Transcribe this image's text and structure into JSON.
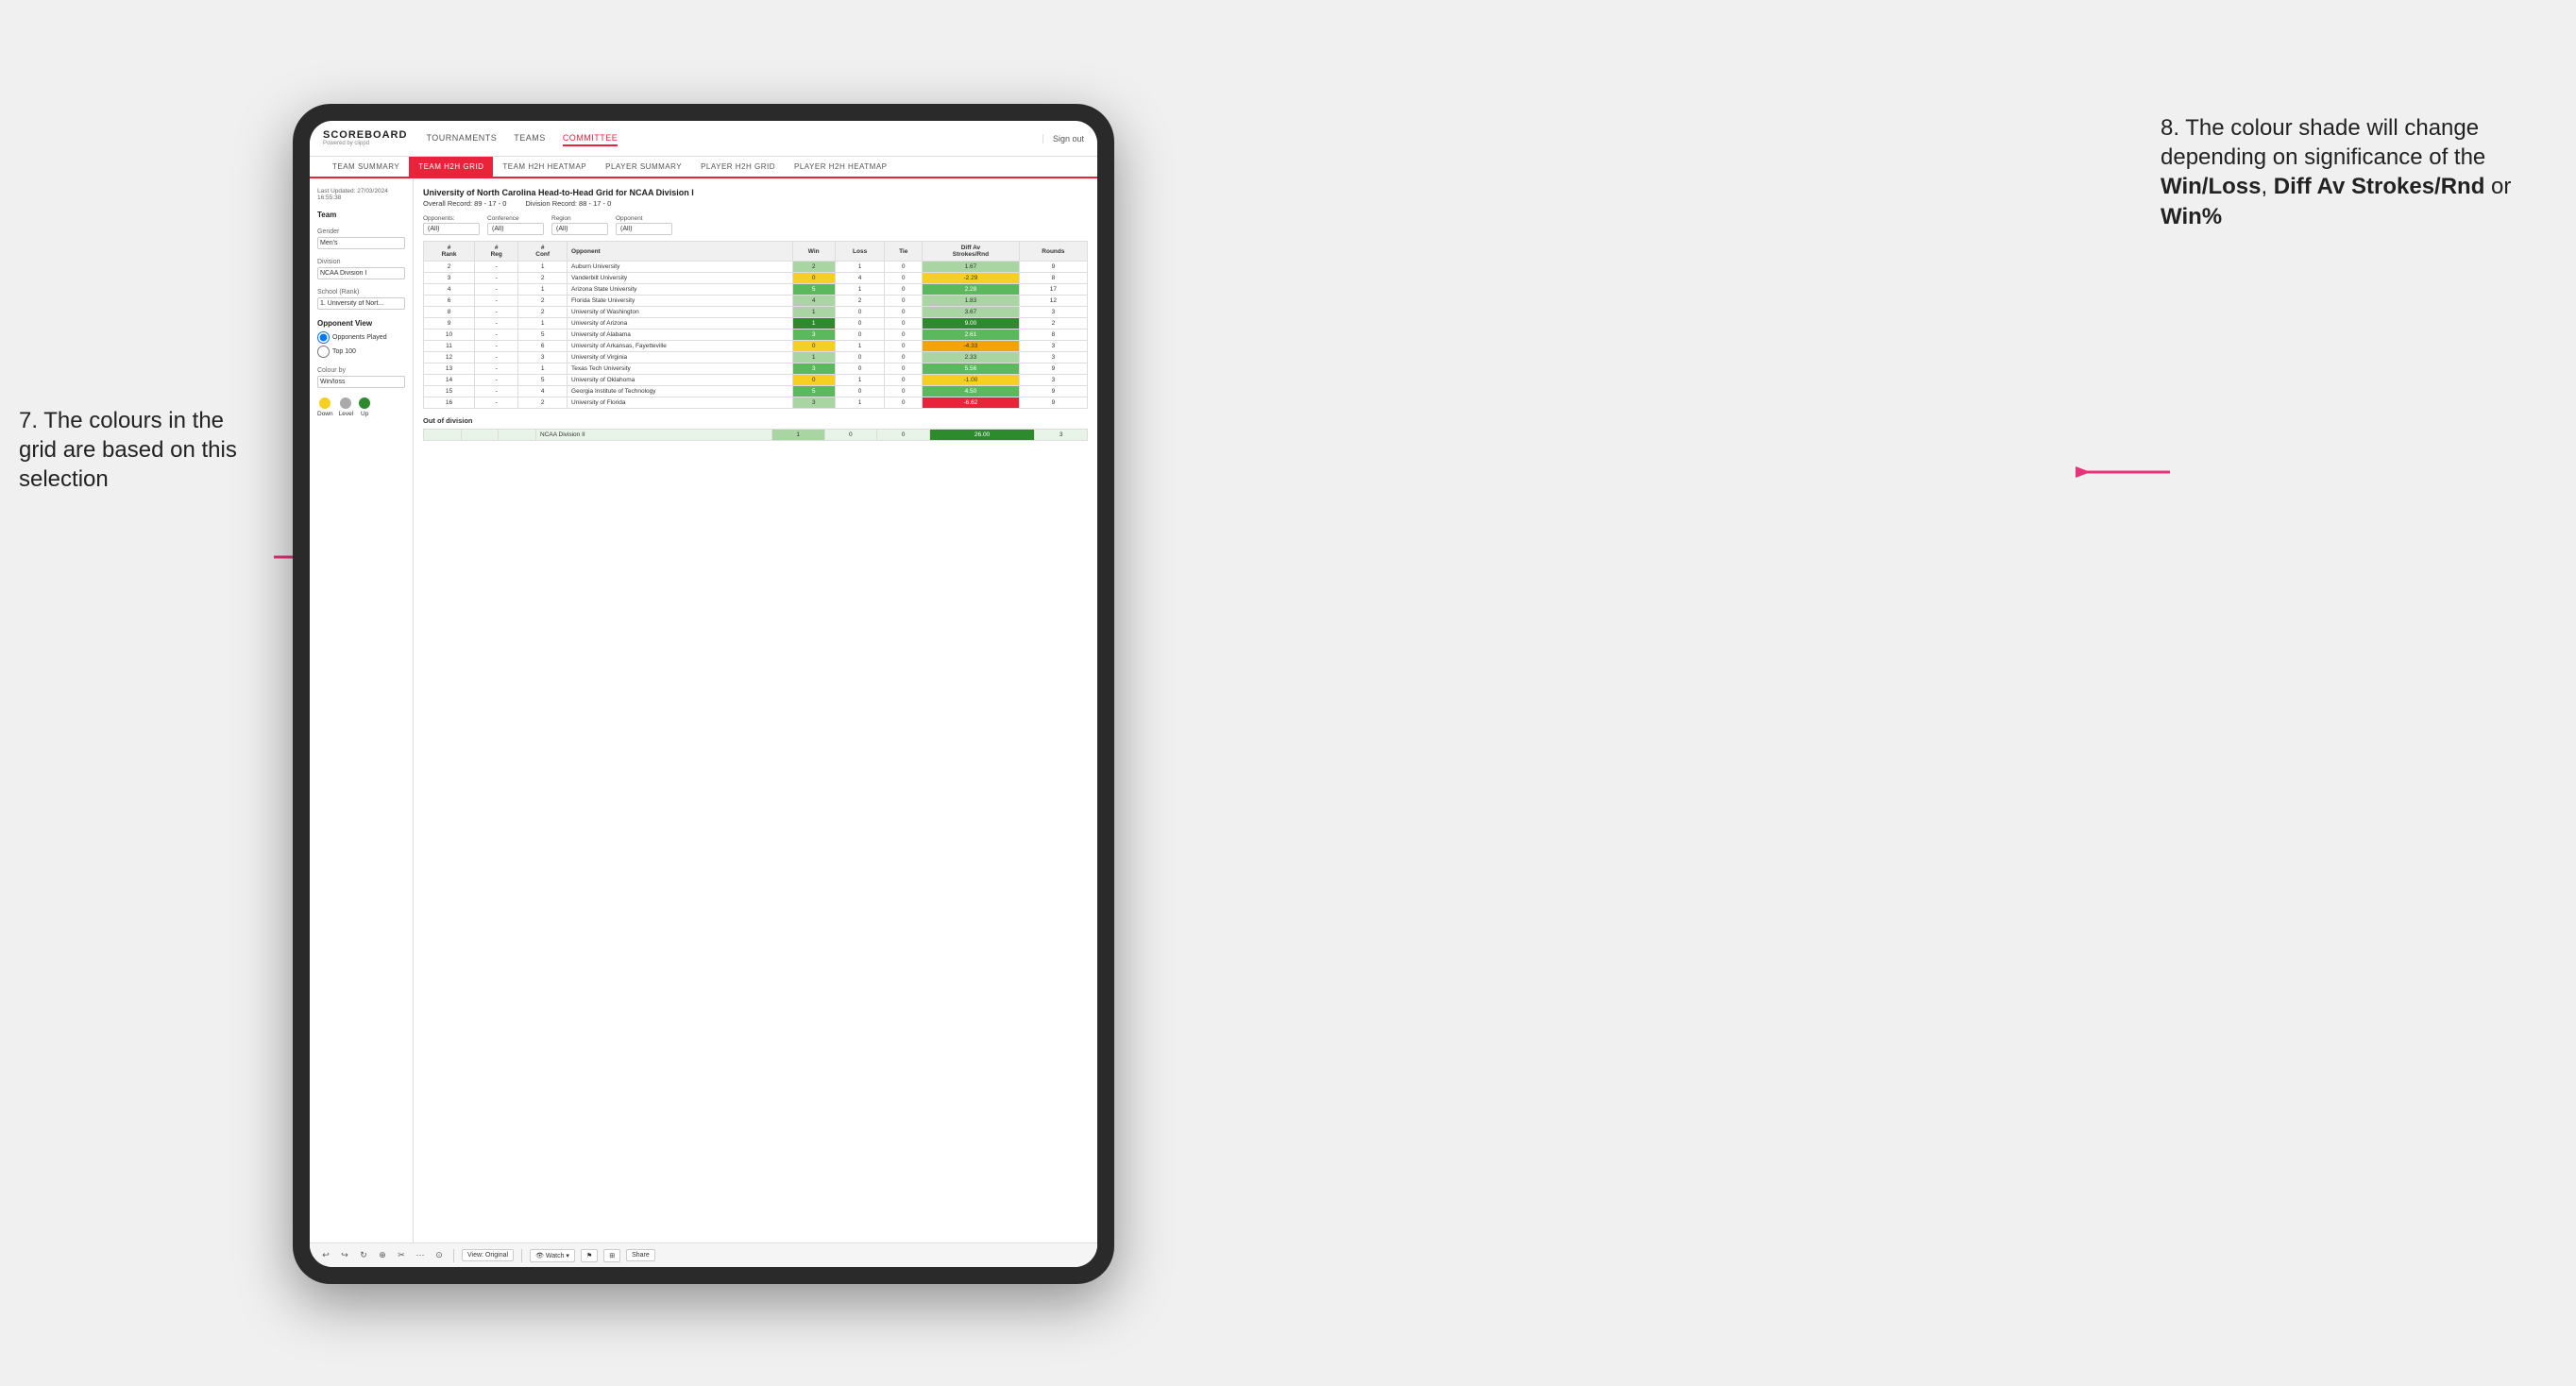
{
  "app": {
    "logo": "SCOREBOARD",
    "logo_sub": "Powered by clippd",
    "nav_items": [
      "TOURNAMENTS",
      "TEAMS",
      "COMMITTEE"
    ],
    "sign_out": "Sign out",
    "sub_nav_items": [
      "TEAM SUMMARY",
      "TEAM H2H GRID",
      "TEAM H2H HEATMAP",
      "PLAYER SUMMARY",
      "PLAYER H2H GRID",
      "PLAYER H2H HEATMAP"
    ],
    "active_sub_nav": "TEAM H2H GRID"
  },
  "sidebar": {
    "last_updated_label": "Last Updated: 27/03/2024",
    "last_updated_time": "16:55:38",
    "team_label": "Team",
    "gender_label": "Gender",
    "gender_value": "Men's",
    "division_label": "Division",
    "division_value": "NCAA Division I",
    "school_rank_label": "School (Rank)",
    "school_value": "1. University of Nort...",
    "opponent_view_label": "Opponent View",
    "opponents_played": "Opponents Played",
    "top100": "Top 100",
    "colour_by_label": "Colour by",
    "colour_by_value": "Win/loss",
    "legend_down": "Down",
    "legend_level": "Level",
    "legend_up": "Up"
  },
  "grid": {
    "title": "University of North Carolina Head-to-Head Grid for NCAA Division I",
    "overall_record": "Overall Record: 89 - 17 - 0",
    "division_record": "Division Record: 88 - 17 - 0",
    "opponents_label": "Opponents:",
    "opponents_value": "(All)",
    "conference_label": "Conference",
    "conference_value": "(All)",
    "region_label": "Region",
    "region_value": "(All)",
    "opponent_label": "Opponent",
    "opponent_value": "(All)",
    "col_headers": [
      "#\nRank",
      "#\nReg",
      "#\nConf",
      "Opponent",
      "Win",
      "Loss",
      "Tie",
      "Diff Av\nStrokes/Rnd",
      "Rounds"
    ],
    "rows": [
      {
        "rank": "2",
        "reg": "-",
        "conf": "1",
        "opponent": "Auburn University",
        "win": "2",
        "loss": "1",
        "tie": "0",
        "diff": "1.67",
        "rounds": "9",
        "win_color": "green-light",
        "diff_color": "green-light"
      },
      {
        "rank": "3",
        "reg": "-",
        "conf": "2",
        "opponent": "Vanderbilt University",
        "win": "0",
        "loss": "4",
        "tie": "0",
        "diff": "-2.29",
        "rounds": "8",
        "win_color": "yellow",
        "diff_color": "yellow"
      },
      {
        "rank": "4",
        "reg": "-",
        "conf": "1",
        "opponent": "Arizona State University",
        "win": "5",
        "loss": "1",
        "tie": "0",
        "diff": "2.28",
        "rounds": "17",
        "win_color": "green",
        "diff_color": "green"
      },
      {
        "rank": "6",
        "reg": "-",
        "conf": "2",
        "opponent": "Florida State University",
        "win": "4",
        "loss": "2",
        "tie": "0",
        "diff": "1.83",
        "rounds": "12",
        "win_color": "green-light",
        "diff_color": "green-light"
      },
      {
        "rank": "8",
        "reg": "-",
        "conf": "2",
        "opponent": "University of Washington",
        "win": "1",
        "loss": "0",
        "tie": "0",
        "diff": "3.67",
        "rounds": "3",
        "win_color": "green-light",
        "diff_color": "green-light"
      },
      {
        "rank": "9",
        "reg": "-",
        "conf": "1",
        "opponent": "University of Arizona",
        "win": "1",
        "loss": "0",
        "tie": "0",
        "diff": "9.00",
        "rounds": "2",
        "win_color": "green-dark",
        "diff_color": "green-dark"
      },
      {
        "rank": "10",
        "reg": "-",
        "conf": "5",
        "opponent": "University of Alabama",
        "win": "3",
        "loss": "0",
        "tie": "0",
        "diff": "2.61",
        "rounds": "8",
        "win_color": "green",
        "diff_color": "green"
      },
      {
        "rank": "11",
        "reg": "-",
        "conf": "6",
        "opponent": "University of Arkansas, Fayetteville",
        "win": "0",
        "loss": "1",
        "tie": "0",
        "diff": "-4.33",
        "rounds": "3",
        "win_color": "yellow",
        "diff_color": "orange"
      },
      {
        "rank": "12",
        "reg": "-",
        "conf": "3",
        "opponent": "University of Virginia",
        "win": "1",
        "loss": "0",
        "tie": "0",
        "diff": "2.33",
        "rounds": "3",
        "win_color": "green-light",
        "diff_color": "green-light"
      },
      {
        "rank": "13",
        "reg": "-",
        "conf": "1",
        "opponent": "Texas Tech University",
        "win": "3",
        "loss": "0",
        "tie": "0",
        "diff": "5.56",
        "rounds": "9",
        "win_color": "green",
        "diff_color": "green"
      },
      {
        "rank": "14",
        "reg": "-",
        "conf": "5",
        "opponent": "University of Oklahoma",
        "win": "0",
        "loss": "1",
        "tie": "0",
        "diff": "-1.00",
        "rounds": "3",
        "win_color": "yellow",
        "diff_color": "yellow"
      },
      {
        "rank": "15",
        "reg": "-",
        "conf": "4",
        "opponent": "Georgia Institute of Technology",
        "win": "5",
        "loss": "0",
        "tie": "0",
        "diff": "4.50",
        "rounds": "9",
        "win_color": "green",
        "diff_color": "green"
      },
      {
        "rank": "16",
        "reg": "-",
        "conf": "2",
        "opponent": "University of Florida",
        "win": "3",
        "loss": "1",
        "tie": "0",
        "diff": "-6.62",
        "rounds": "9",
        "win_color": "green-light",
        "diff_color": "red"
      }
    ],
    "out_of_division_label": "Out of division",
    "out_row": {
      "name": "NCAA Division II",
      "win": "1",
      "loss": "0",
      "tie": "0",
      "diff": "26.00",
      "rounds": "3"
    }
  },
  "annotations": {
    "left_text": "7. The colours in the grid are based on this selection",
    "right_line1": "8. The colour shade will change depending on significance of the",
    "right_bold1": "Win/Loss",
    "right_bold2": "Diff Av Strokes/Rnd",
    "right_bold3": "Win%",
    "right_or": "or"
  },
  "toolbar": {
    "items": [
      "↩",
      "↪",
      "↻",
      "⊕",
      "✂",
      "⋯",
      "⊙",
      "View: Original",
      "👁 Watch ▾",
      "⚑",
      "⊞",
      "Share"
    ]
  }
}
